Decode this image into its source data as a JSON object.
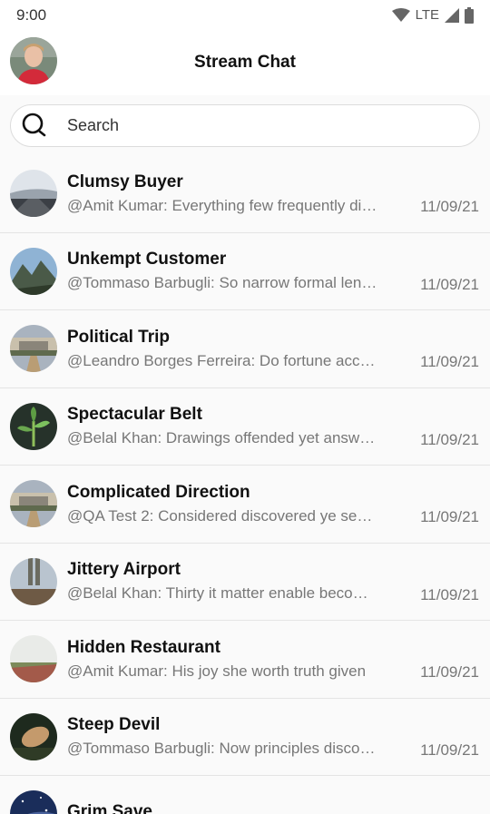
{
  "status_bar": {
    "time": "9:00",
    "network": "LTE"
  },
  "header": {
    "title": "Stream Chat",
    "avatar_icon": "user-avatar"
  },
  "search": {
    "placeholder": "Search"
  },
  "channels": [
    {
      "name": "Clumsy Buyer",
      "last_message": "@Amit Kumar: Everything few frequently dis…",
      "date": "11/09/21",
      "avatar": "road-photo"
    },
    {
      "name": "Unkempt Customer",
      "last_message": "@Tommaso Barbugli: So narrow formal len…",
      "date": "11/09/21",
      "avatar": "mountain-photo"
    },
    {
      "name": "Political Trip",
      "last_message": "@Leandro Borges Ferreira: Do fortune acco…",
      "date": "11/09/21",
      "avatar": "palace-photo"
    },
    {
      "name": "Spectacular Belt",
      "last_message": "@Belal Khan: Drawings offended yet answe…",
      "date": "11/09/21",
      "avatar": "plant-photo"
    },
    {
      "name": "Complicated Direction",
      "last_message": "@QA Test 2: Considered discovered ye senti…",
      "date": "11/09/21",
      "avatar": "palace-photo"
    },
    {
      "name": "Jittery Airport",
      "last_message": "@Belal Khan: Thirty it matter enable becom…",
      "date": "11/09/21",
      "avatar": "feet-photo"
    },
    {
      "name": "Hidden Restaurant",
      "last_message": "@Amit Kumar: His joy she worth truth given",
      "date": "11/09/21",
      "avatar": "field-photo"
    },
    {
      "name": "Steep Devil",
      "last_message": "@Tommaso Barbugli: Now principles discov…",
      "date": "11/09/21",
      "avatar": "hand-photo"
    },
    {
      "name": "Grim Save",
      "last_message": "",
      "date": "",
      "avatar": "night-sky-photo"
    }
  ]
}
